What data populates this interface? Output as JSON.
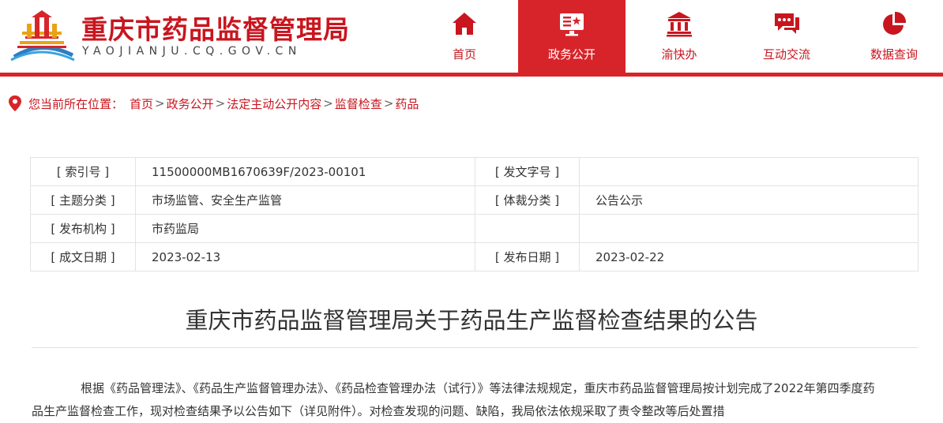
{
  "header": {
    "site_title": "重庆市药品监督管理局",
    "site_domain": "YAOJIANJU.CQ.GOV.CN",
    "nav": [
      {
        "label": "首页",
        "icon": "home-icon",
        "active": false
      },
      {
        "label": "政务公开",
        "icon": "monitor-icon",
        "active": true
      },
      {
        "label": "渝快办",
        "icon": "government-building-icon",
        "active": false
      },
      {
        "label": "互动交流",
        "icon": "chat-bubbles-icon",
        "active": false
      },
      {
        "label": "数据查询",
        "icon": "pie-chart-icon",
        "active": false
      }
    ],
    "brand_color": "#d7242a"
  },
  "breadcrumb": {
    "label": "您当前所在位置：",
    "items": [
      "首页",
      "政务公开",
      "法定主动公开内容",
      "监督检查",
      "药品"
    ],
    "separator": ">"
  },
  "meta": {
    "index_no_key": "[ 索引号 ]",
    "index_no_value": "11500000MB1670639F/2023-00101",
    "doc_no_key": "[ 发文字号 ]",
    "doc_no_value": "",
    "topic_key": "[ 主题分类 ]",
    "topic_value": "市场监管、安全生产监管",
    "genre_key": "[ 体裁分类 ]",
    "genre_value": "公告公示",
    "issuer_key": "[ 发布机构 ]",
    "issuer_value": "市药监局",
    "created_key": "[ 成文日期 ]",
    "created_value": "2023-02-13",
    "published_key": "[ 发布日期 ]",
    "published_value": "2023-02-22"
  },
  "article": {
    "title": "重庆市药品监督管理局关于药品生产监督检查结果的公告",
    "paragraph": "根据《药品管理法》、《药品生产监督管理办法》、《药品检查管理办法（试行）》等法律法规规定，重庆市药品监督管理局按计划完成了2022年第四季度药品生产监督检查工作，现对检查结果予以公告如下（详见附件）。对检查发现的问题、缺陷，我局依法依规采取了责令整改等后处置措"
  }
}
